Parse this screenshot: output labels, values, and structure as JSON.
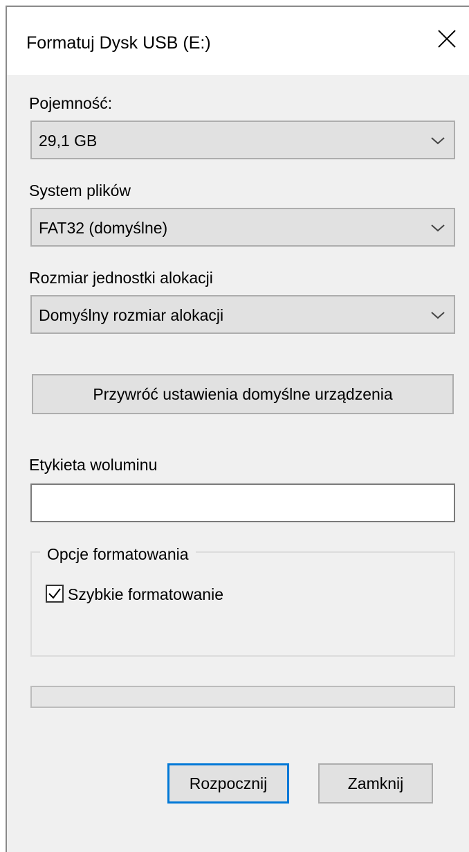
{
  "dialog": {
    "title": "Formatuj Dysk USB (E:)",
    "close_icon": "close-icon"
  },
  "capacity": {
    "label": "Pojemność:",
    "value": "29,1 GB"
  },
  "file_system": {
    "label": "System plików",
    "value": "FAT32 (domyślne)"
  },
  "allocation": {
    "label": "Rozmiar jednostki alokacji",
    "value": "Domyślny rozmiar alokacji"
  },
  "restore_defaults_label": "Przywróć ustawienia domyślne urządzenia",
  "volume_label": {
    "label": "Etykieta woluminu",
    "value": ""
  },
  "format_options": {
    "legend": "Opcje formatowania",
    "quick_format": {
      "label": "Szybkie formatowanie",
      "checked": true
    }
  },
  "progress": {
    "value": 0
  },
  "buttons": {
    "start_label": "Rozpocznij",
    "close_label": "Zamknij"
  },
  "colors": {
    "accent_focus": "#0078d7",
    "window_bg": "#f0f0f0",
    "progress_fill": "#06b025"
  }
}
